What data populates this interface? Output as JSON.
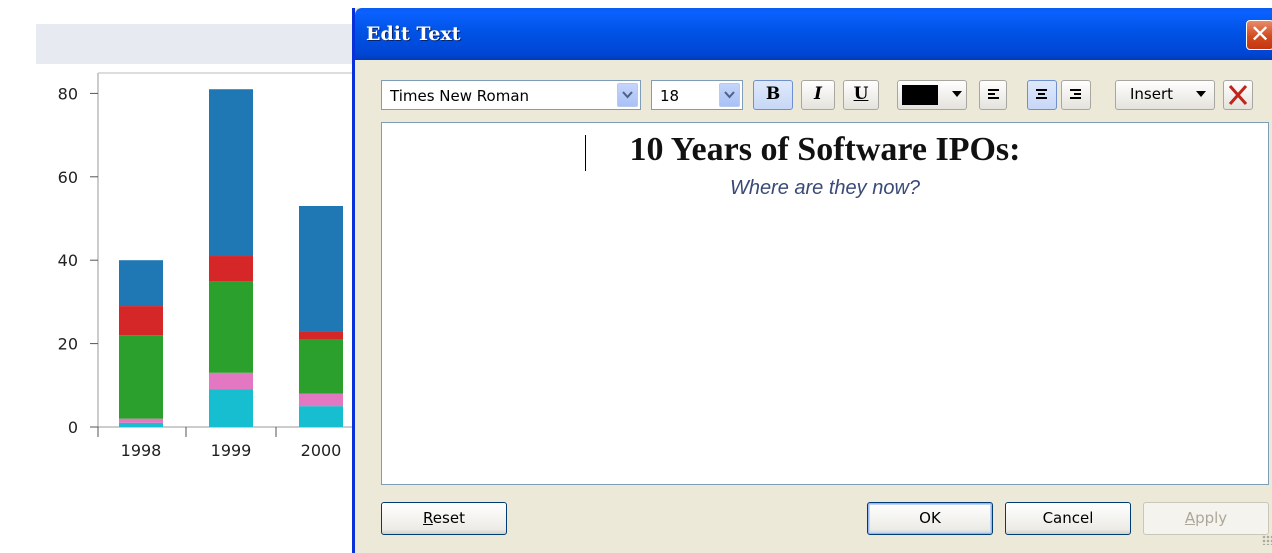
{
  "chart_data": {
    "type": "bar",
    "stacked": true,
    "categories": [
      "1998",
      "1999",
      "2000"
    ],
    "y_ticks": [
      "0",
      "20",
      "40",
      "60",
      "80"
    ],
    "ylim": [
      0,
      85
    ],
    "series": [
      {
        "color": "#17becf",
        "values": [
          1,
          9,
          5
        ]
      },
      {
        "color": "#e377c2",
        "values": [
          1,
          4,
          3
        ]
      },
      {
        "color": "#2ca02c",
        "values": [
          20,
          22,
          13
        ]
      },
      {
        "color": "#d62728",
        "values": [
          7,
          6,
          2
        ]
      },
      {
        "color": "#1f77b4",
        "values": [
          11,
          40,
          30
        ]
      }
    ]
  },
  "dialog": {
    "title": "Edit Text",
    "toolbar": {
      "font": "Times New Roman",
      "size": "18",
      "bold": "B",
      "italic": "I",
      "underline": "U",
      "color": "#000000",
      "insert": "Insert"
    },
    "editor": {
      "title_line": "10 Years of Software IPOs:",
      "subtitle_line": "Where are they now?"
    },
    "buttons": {
      "reset": "Reset",
      "ok": "OK",
      "cancel": "Cancel",
      "apply": "Apply"
    }
  }
}
